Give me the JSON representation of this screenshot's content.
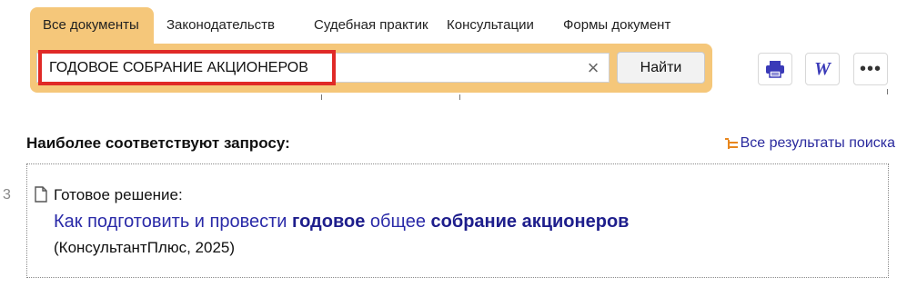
{
  "tabs": [
    {
      "label": "Все документы",
      "active": true
    },
    {
      "label": "Законодательств",
      "active": false
    },
    {
      "label": "Судебная практик",
      "active": false
    },
    {
      "label": "Консультации",
      "active": false
    },
    {
      "label": "Формы документ",
      "active": false
    }
  ],
  "search": {
    "value": "ГОДОВОЕ СОБРАНИЕ АКЦИОНЕРОВ",
    "clear_icon": "close-icon",
    "button_label": "Найти"
  },
  "toolbar": {
    "print_icon": "printer-icon",
    "word_icon": "W",
    "more_icon": "•••"
  },
  "results": {
    "heading": "Наиболее соответствуют запросу:",
    "all_results_label": "Все результаты поиска",
    "items": [
      {
        "number": "3",
        "label": "Готовое решение:",
        "title_parts": [
          {
            "text": "Как подготовить и провести ",
            "bold": false
          },
          {
            "text": "годовое",
            "bold": true
          },
          {
            "text": " общее ",
            "bold": false
          },
          {
            "text": "собрание акционеров",
            "bold": true
          }
        ],
        "source": "(КонсультантПлюс, 2025)"
      }
    ]
  },
  "colors": {
    "tab_active": "#f5c77a",
    "highlight": "#e02a27",
    "link": "#2a2aa8",
    "accent_icon": "#e8871e"
  }
}
